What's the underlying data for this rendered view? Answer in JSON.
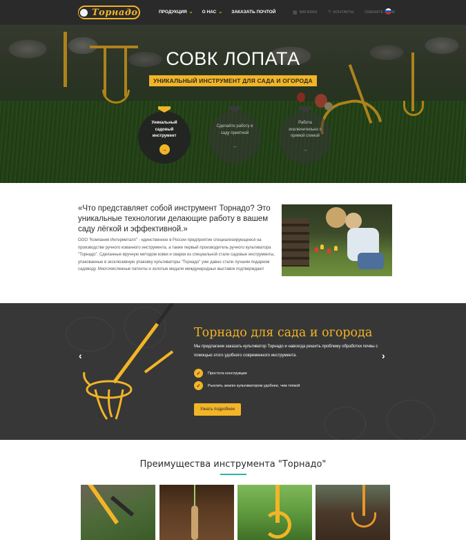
{
  "header": {
    "logo_text": "Торнадо",
    "nav": [
      {
        "label": "ПРОДУКЦИЯ",
        "has_dropdown": true
      },
      {
        "label": "О НАС",
        "has_dropdown": true
      },
      {
        "label": "ЗАКАЗАТЬ ПОЧТОЙ",
        "has_dropdown": false
      }
    ],
    "right_links": [
      {
        "label": "МАГАЗИН",
        "icon": "shop-icon"
      },
      {
        "label": "КОНТАКТЫ",
        "icon": "location-pin-icon"
      },
      {
        "label": "СМЕНИТЕ ЯЗЫК",
        "icon": ""
      }
    ],
    "language_flag": "russia-flag-icon"
  },
  "hero": {
    "title": "СОВК ЛОПАТА",
    "subtitle": "УНИКАЛЬНЫЙ ИНСТРУМЕНТ ДЛЯ САДА И ОГОРОДА",
    "features": [
      {
        "text": "Уникальный садовый инструмент",
        "active": true
      },
      {
        "text": "Сделайте работу в саду приятной",
        "active": false
      },
      {
        "text": "Работа исключительно с прямой спиной",
        "active": false
      }
    ]
  },
  "about": {
    "heading": "«Что представляет собой инструмент Торнадо? Это уникальные технологии делающие работу в вашем саду лёгкой и эффективной.»",
    "text": "ООО \"Компания Интерметалл\" - единственное в России предприятие специализирующееся на производстве ручного кованного инструмента, а также первый производитель ручного культиватора \"Торнадо\". Сделанные вручную методом ковки и сварки из специальной стали садовые инструменты, упакованные в эксклюзивную упаковку культиваторы \"Торнадо\" уже давно стали лучшим подарком садоводу. Многочисленные патенты и золотые медали международных выставок подтверждают"
  },
  "slider": {
    "title": "Торнадо для сада и огорода",
    "description": "Мы предлагаем заказать культиватор Торнадо и навсегда решить проблему обработки почвы с помощью этого удобного современного инструмента.",
    "checks": [
      "Простота конструкции",
      "Рыхлить землю культиватором удобнее, чем тяпкой"
    ],
    "button": "Узнать подробнее",
    "prev_icon": "‹",
    "next_icon": "›"
  },
  "advantages": {
    "title": "Преимущества инструмента \"Торнадо\""
  },
  "colors": {
    "accent": "#f2b527",
    "dark": "#373737",
    "topbar": "#2a2a2a",
    "teal": "#2bb3a3"
  }
}
